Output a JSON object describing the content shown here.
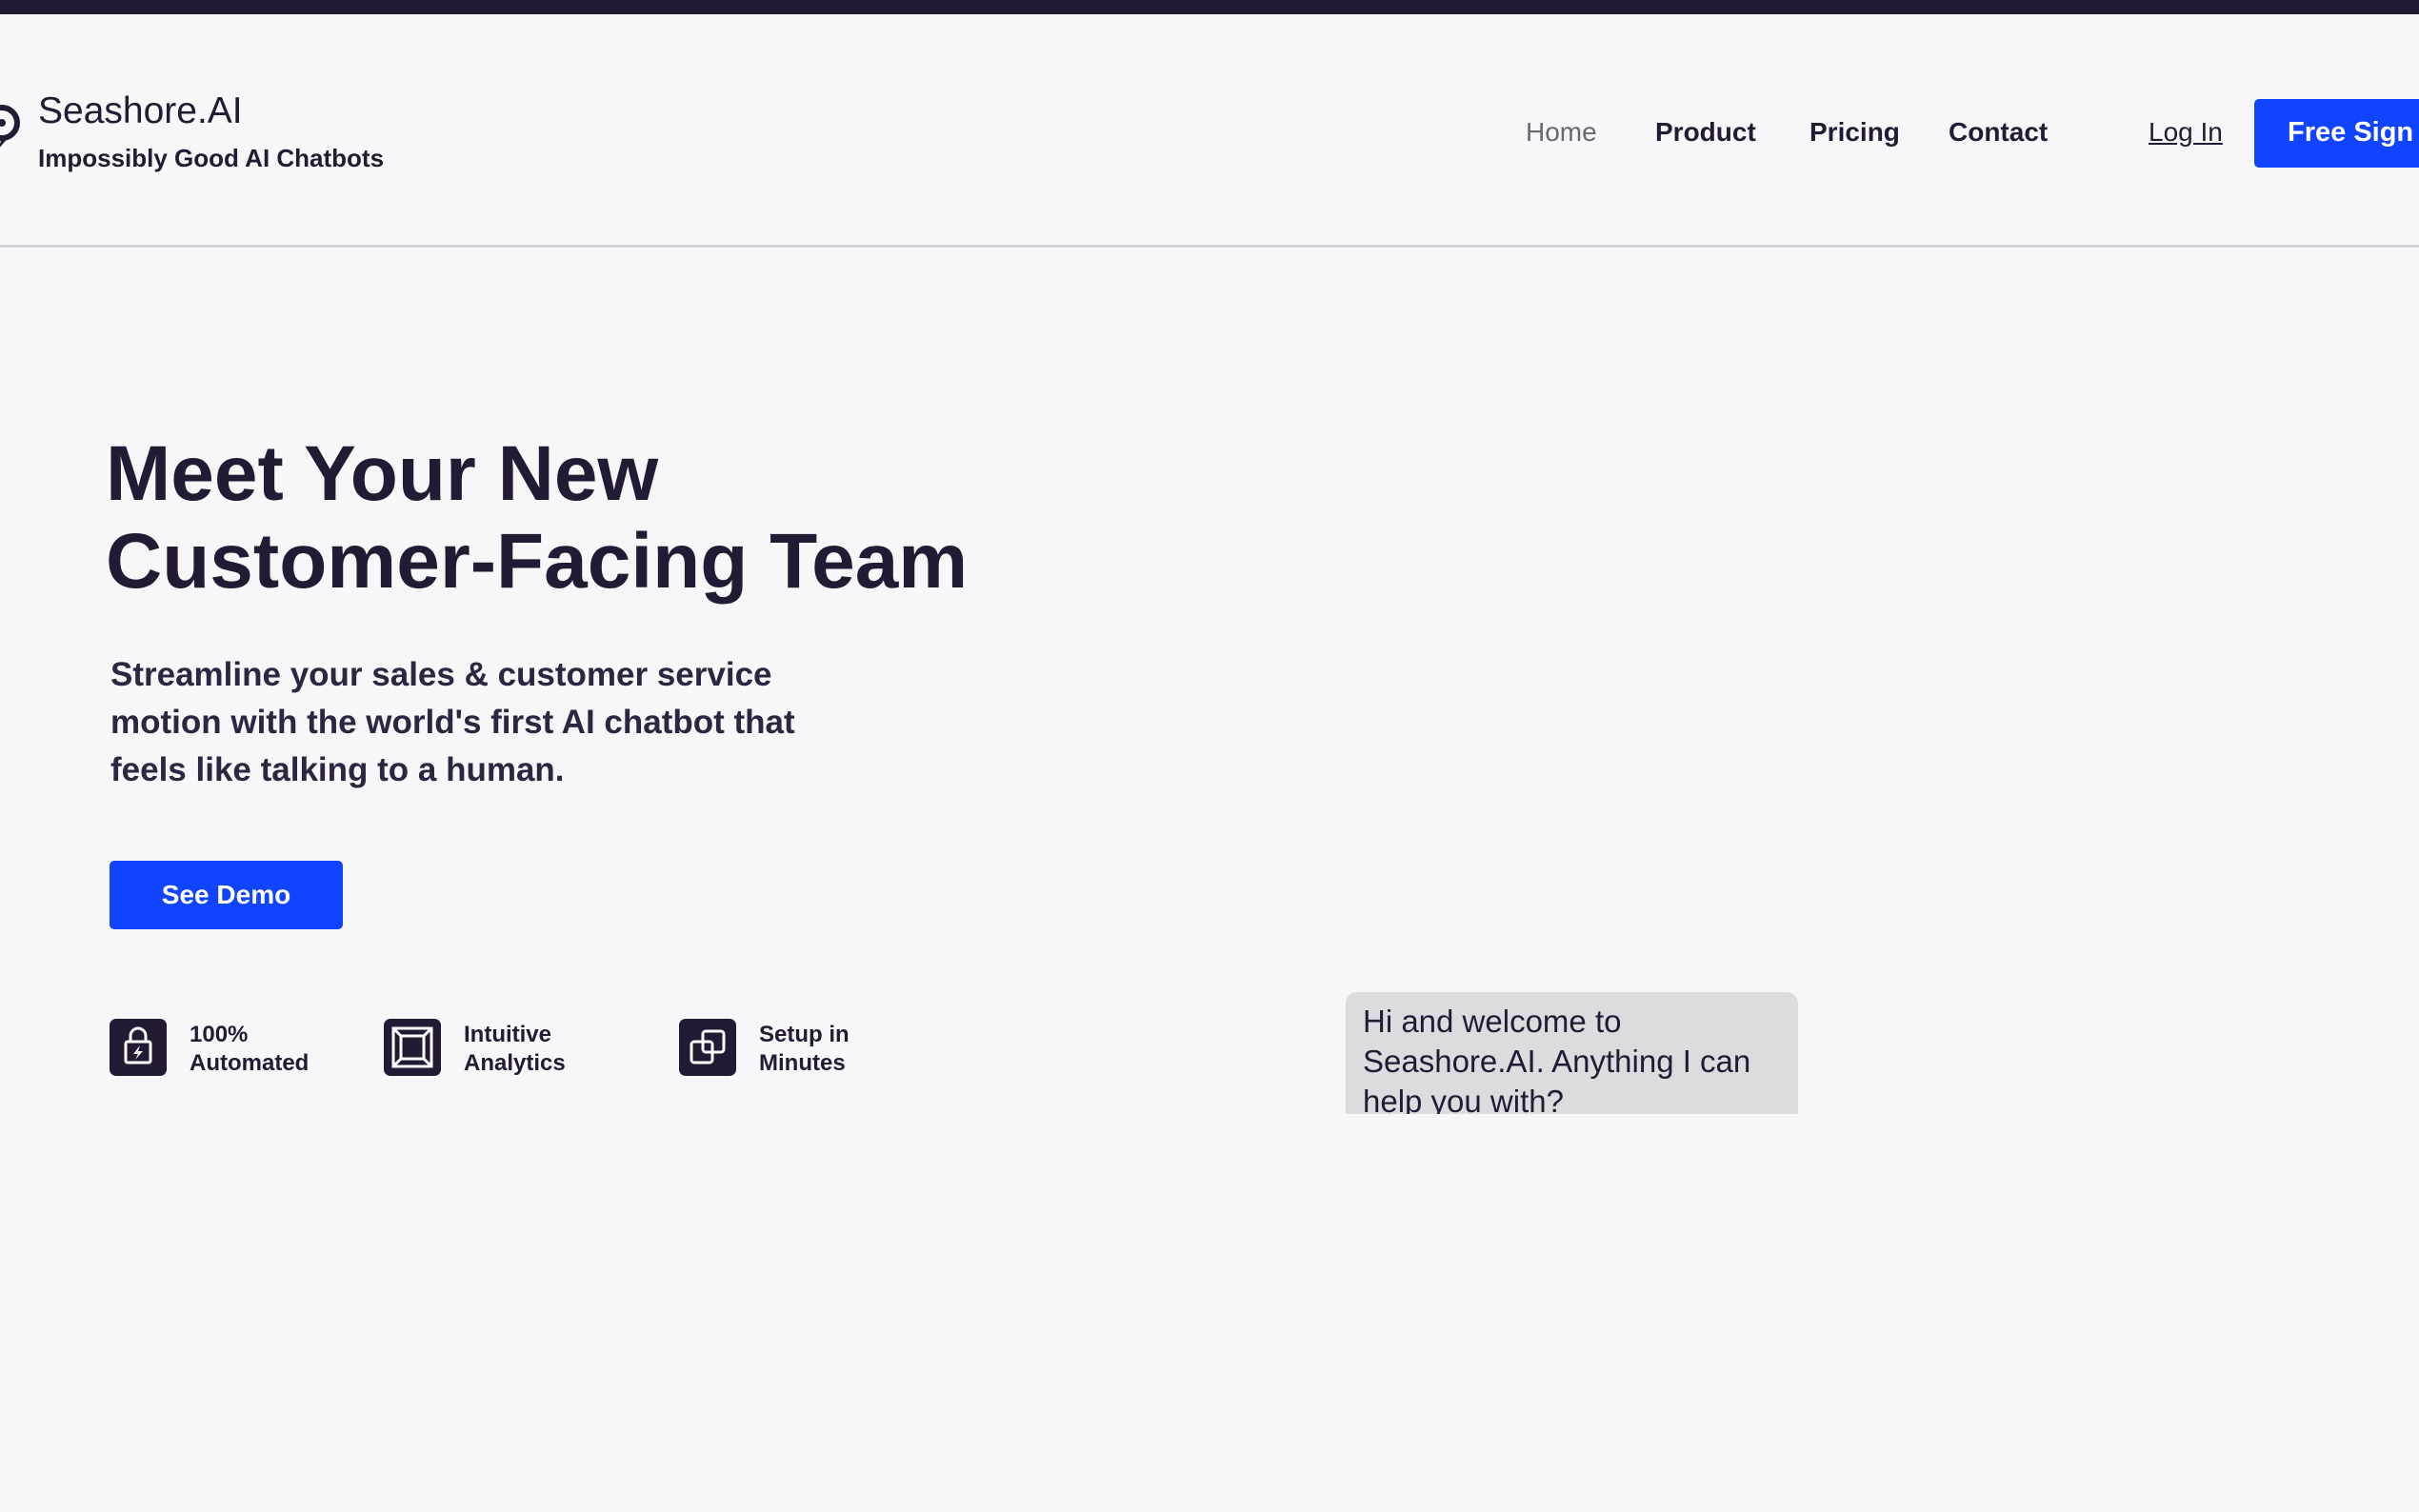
{
  "brand": {
    "name": "Seashore.AI",
    "tagline": "Impossibly Good AI Chatbots",
    "logo_icon": "chat-logo-icon"
  },
  "nav": {
    "items": [
      {
        "label": "Home",
        "active": true
      },
      {
        "label": "Product",
        "active": false
      },
      {
        "label": "Pricing",
        "active": false
      },
      {
        "label": "Contact",
        "active": false
      }
    ],
    "login_label": "Log In",
    "signup_label": "Free Sign"
  },
  "hero": {
    "title_line1": "Meet Your New",
    "title_line2": "Customer-Facing Team",
    "subtitle": "Streamline your sales & customer service motion with the world's first AI chatbot that feels like talking to a human.",
    "cta_label": "See Demo"
  },
  "features": [
    {
      "line1": "100%",
      "line2": "Automated",
      "icon": "lock-bolt-icon"
    },
    {
      "line1": "Intuitive",
      "line2": "Analytics",
      "icon": "frame-icon"
    },
    {
      "line1": "Setup in",
      "line2": "Minutes",
      "icon": "overlap-squares-icon"
    }
  ],
  "chat": {
    "message": "Hi and welcome to Seashore.AI. Anything I can help you with?"
  },
  "colors": {
    "accent": "#1044ff",
    "text_dark": "#231a33",
    "background": "#f7f6f9",
    "bubble": "#dcdbde"
  }
}
